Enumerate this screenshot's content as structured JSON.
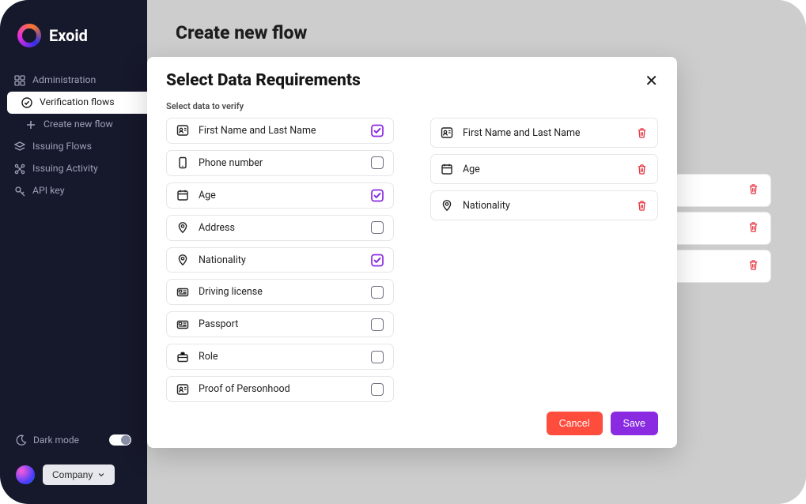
{
  "brand": {
    "name": "Exoid"
  },
  "sidebar": {
    "items": [
      {
        "label": "Administration"
      },
      {
        "label": "Verification flows"
      },
      {
        "label": "Create new flow"
      },
      {
        "label": "Issuing Flows"
      },
      {
        "label": "Issuing Activity"
      },
      {
        "label": "API key"
      }
    ],
    "dark_mode_label": "Dark mode",
    "company_label": "Company"
  },
  "page": {
    "title": "Create new flow"
  },
  "modal": {
    "title": "Select Data Requirements",
    "subtitle": "Select data to verify",
    "available": [
      {
        "label": "First Name and Last Name",
        "checked": true,
        "icon": "person-card"
      },
      {
        "label": "Phone number",
        "checked": false,
        "icon": "phone"
      },
      {
        "label": "Age",
        "checked": true,
        "icon": "calendar"
      },
      {
        "label": "Address",
        "checked": false,
        "icon": "pin"
      },
      {
        "label": "Nationality",
        "checked": true,
        "icon": "pin"
      },
      {
        "label": "Driving license",
        "checked": false,
        "icon": "id-card"
      },
      {
        "label": "Passport",
        "checked": false,
        "icon": "id-card"
      },
      {
        "label": "Role",
        "checked": false,
        "icon": "briefcase"
      },
      {
        "label": "Proof of Personhood",
        "checked": false,
        "icon": "person-card"
      }
    ],
    "selected": [
      {
        "label": "First Name and Last Name",
        "icon": "person-card"
      },
      {
        "label": "Age",
        "icon": "calendar"
      },
      {
        "label": "Nationality",
        "icon": "pin"
      }
    ],
    "buttons": {
      "cancel": "Cancel",
      "save": "Save"
    }
  },
  "colors": {
    "accent_purple": "#8a2be2",
    "danger_red": "#e63946",
    "sidebar_bg": "#16182b"
  }
}
